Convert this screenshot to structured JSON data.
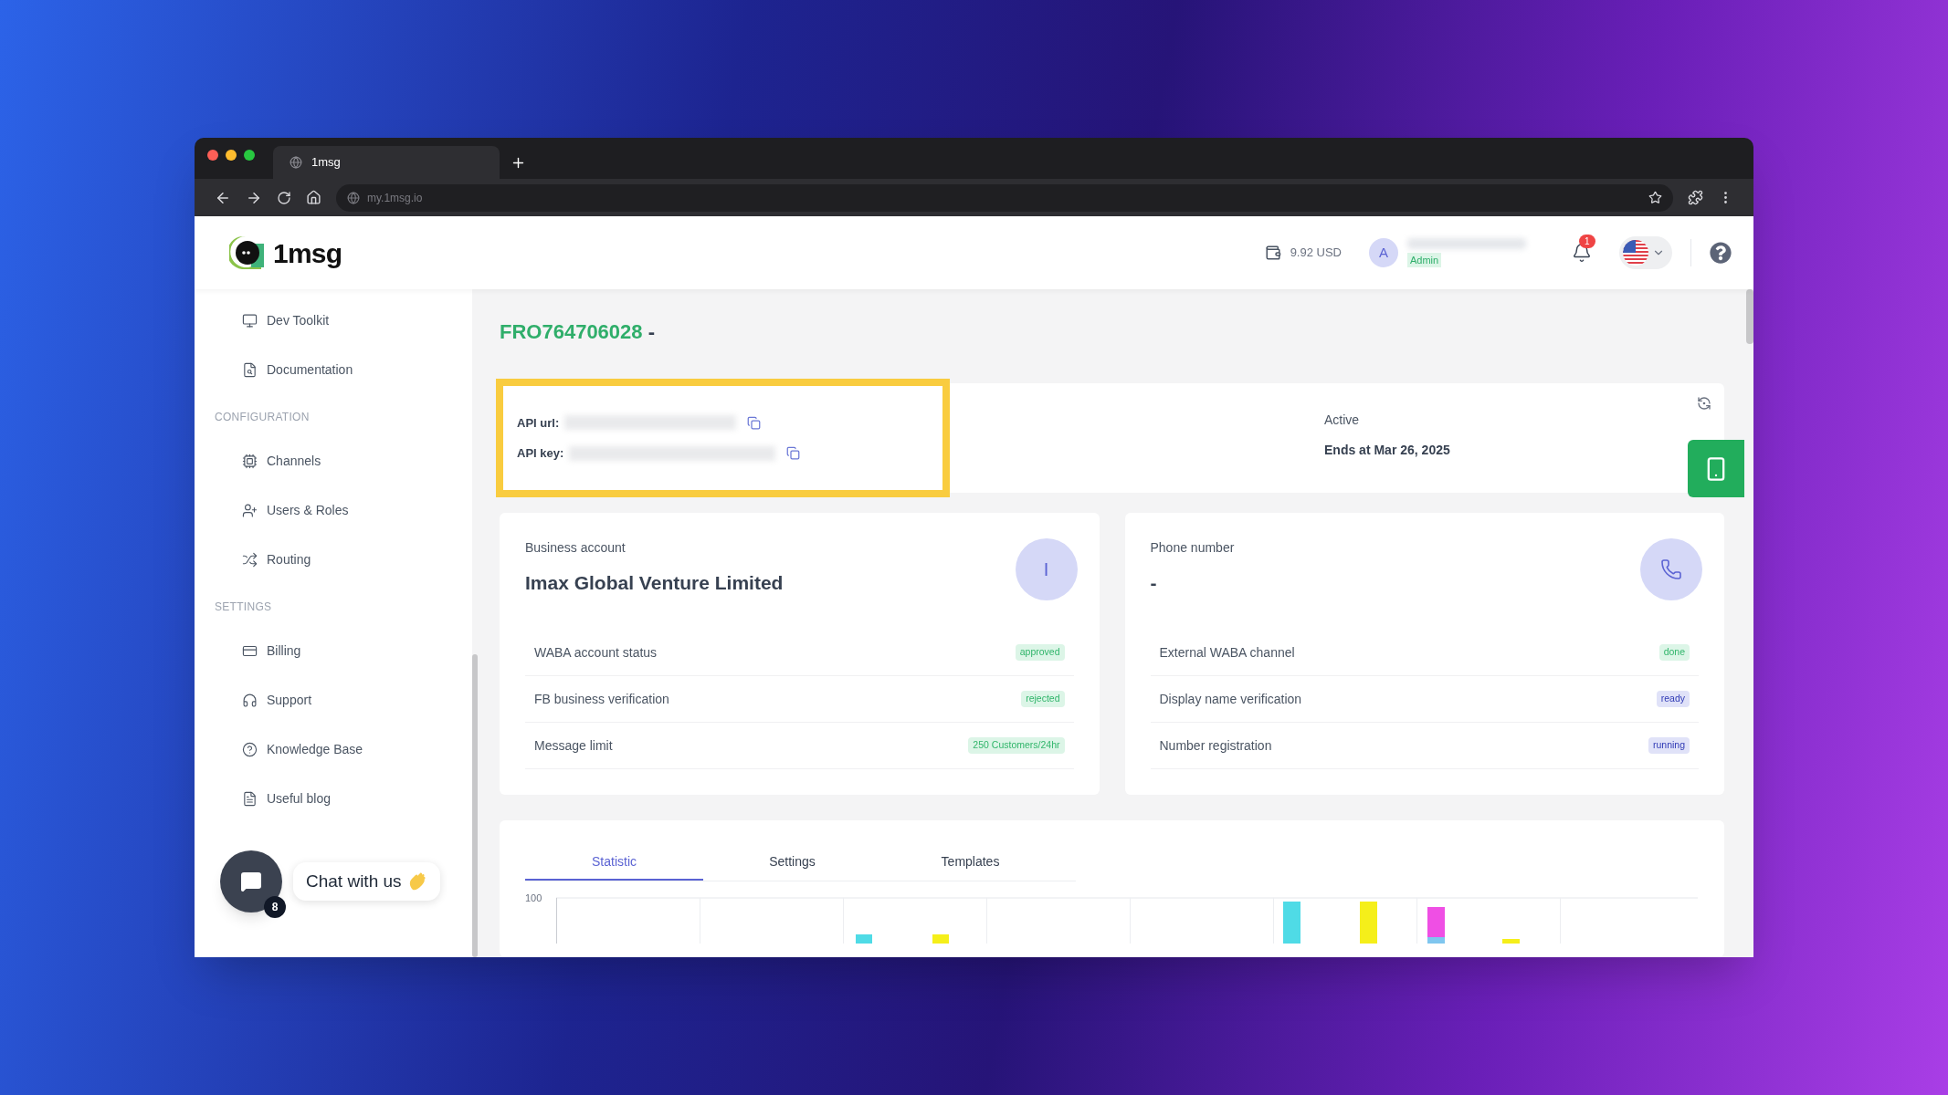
{
  "browser": {
    "tab_title": "1msg",
    "address": "my.1msg.io"
  },
  "header": {
    "logo": "1msg",
    "balance": "9.92 USD",
    "user": {
      "initial": "A",
      "role": "Admin"
    },
    "notifications": "1"
  },
  "sidebar": {
    "items": [
      {
        "label": "Dev Toolkit",
        "kind": "monitor"
      },
      {
        "label": "Documentation",
        "kind": "document"
      }
    ],
    "sections": [
      {
        "heading": "CONFIGURATION",
        "items": [
          {
            "label": "Channels",
            "kind": "chip"
          },
          {
            "label": "Users & Roles",
            "kind": "user-plus"
          },
          {
            "label": "Routing",
            "kind": "shuffle"
          }
        ]
      },
      {
        "heading": "SETTINGS",
        "items": [
          {
            "label": "Billing",
            "kind": "card"
          },
          {
            "label": "Support",
            "kind": "headset"
          },
          {
            "label": "Knowledge Base",
            "kind": "help"
          },
          {
            "label": "Useful blog",
            "kind": "blog"
          }
        ]
      }
    ]
  },
  "chat": {
    "label": "Chat with us",
    "count": "8"
  },
  "title": {
    "id": "FRO764706028",
    "suffix": "-"
  },
  "api": {
    "fields": [
      {
        "label": "API url:"
      },
      {
        "label": "API key:"
      }
    ]
  },
  "subscription": {
    "status": "Active",
    "ends": "Ends at Mar 26, 2025"
  },
  "cards": [
    {
      "label": "Business account",
      "value": "Imax Global Venture Limited",
      "avatar": {
        "kind": "letter",
        "text": "I"
      },
      "rows": [
        {
          "label": "WABA account status",
          "badge": "approved",
          "color": "#dcf5e7"
        },
        {
          "label": "FB business verification",
          "badge": "rejected",
          "color": "#dcf5e7"
        },
        {
          "label": "Message limit",
          "badge": "250 Customers/24hr",
          "color": "#dcf5e7"
        }
      ]
    },
    {
      "label": "Phone number",
      "value": "-",
      "avatar": {
        "kind": "phone"
      },
      "rows": [
        {
          "label": "External WABA channel",
          "badge": "done",
          "color": "#dcf5e7"
        },
        {
          "label": "Display name verification",
          "badge": "ready",
          "color": "#e0e2f8"
        },
        {
          "label": "Number registration",
          "badge": "running",
          "color": "#e0e2f8"
        }
      ]
    }
  ],
  "tabs": [
    {
      "label": "Statistic",
      "selected": true
    },
    {
      "label": "Settings",
      "selected": false
    },
    {
      "label": "Templates",
      "selected": false
    }
  ],
  "chart": {
    "top_tick": "100"
  }
}
